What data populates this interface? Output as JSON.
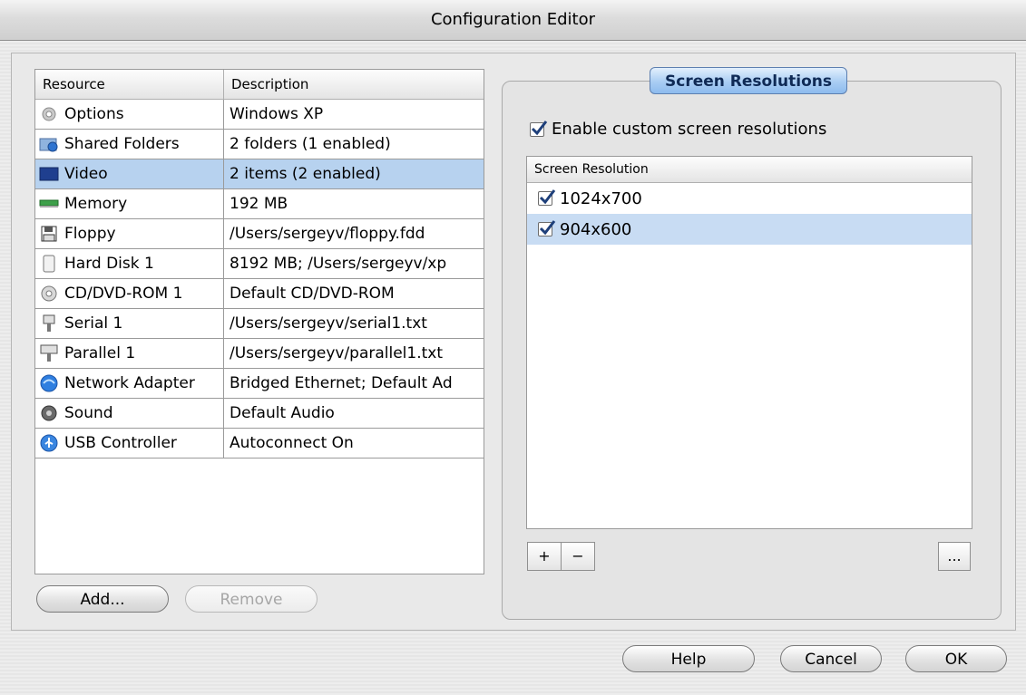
{
  "window": {
    "title": "Configuration Editor"
  },
  "resources": {
    "columns": [
      "Resource",
      "Description"
    ],
    "rows": [
      {
        "name": "Options",
        "description": "Windows XP",
        "icon": "gear-icon",
        "selected": false
      },
      {
        "name": "Shared Folders",
        "description": "2 folders (1 enabled)",
        "icon": "shared-folder-icon",
        "selected": false
      },
      {
        "name": "Video",
        "description": "2 items (2 enabled)",
        "icon": "monitor-icon",
        "selected": true
      },
      {
        "name": "Memory",
        "description": "192 MB",
        "icon": "memory-icon",
        "selected": false
      },
      {
        "name": "Floppy",
        "description": "/Users/sergeyv/floppy.fdd",
        "icon": "floppy-icon",
        "selected": false
      },
      {
        "name": "Hard Disk 1",
        "description": "8192 MB; /Users/sergeyv/xp",
        "icon": "hard-disk-icon",
        "selected": false
      },
      {
        "name": "CD/DVD-ROM 1",
        "description": "Default CD/DVD-ROM",
        "icon": "cd-icon",
        "selected": false
      },
      {
        "name": "Serial 1",
        "description": "/Users/sergeyv/serial1.txt",
        "icon": "serial-port-icon",
        "selected": false
      },
      {
        "name": "Parallel 1",
        "description": "/Users/sergeyv/parallel1.txt",
        "icon": "parallel-port-icon",
        "selected": false
      },
      {
        "name": "Network Adapter",
        "description": "Bridged Ethernet; Default Ad",
        "icon": "network-icon",
        "selected": false
      },
      {
        "name": "Sound",
        "description": "Default Audio",
        "icon": "sound-icon",
        "selected": false
      },
      {
        "name": "USB Controller",
        "description": "Autoconnect On",
        "icon": "usb-icon",
        "selected": false
      }
    ]
  },
  "buttons": {
    "add": "Add...",
    "remove": "Remove",
    "help": "Help",
    "cancel": "Cancel",
    "ok": "OK",
    "plus": "+",
    "minus": "−",
    "more": "..."
  },
  "screen_resolutions": {
    "group_title": "Screen Resolutions",
    "enable_label": "Enable custom screen resolutions",
    "enable_checked": true,
    "list_header": "Screen Resolution",
    "items": [
      {
        "label": "1024x700",
        "checked": true,
        "selected": false
      },
      {
        "label": "904x600",
        "checked": true,
        "selected": true
      }
    ]
  },
  "colors": {
    "selection": "#b7d2ef",
    "group_tab": "#a9cdf3",
    "checkbox_check": "#1e3f7a"
  }
}
